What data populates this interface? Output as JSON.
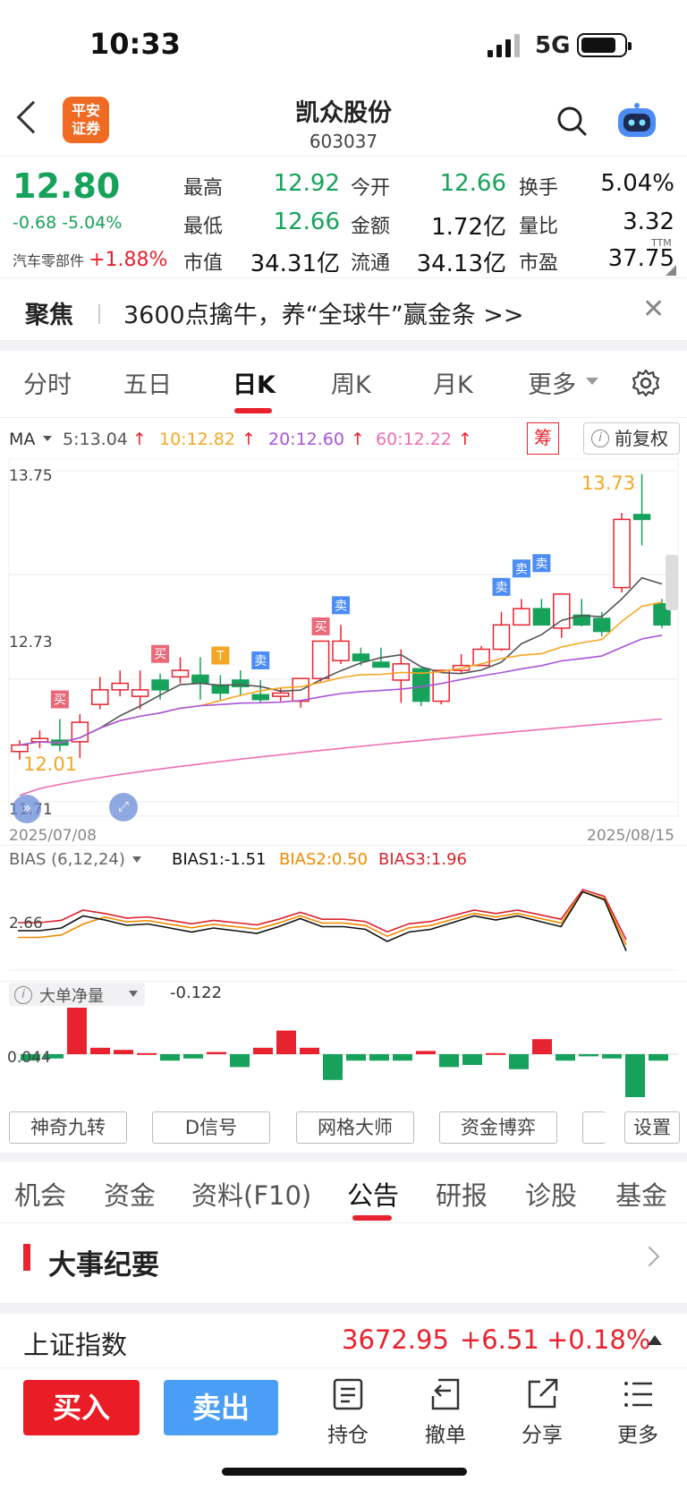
{
  "status_bar": {
    "time": "10:33",
    "network": "5G"
  },
  "header": {
    "broker_logo": "平安证券",
    "stock_name": "凯众股份",
    "stock_code": "603037"
  },
  "quote": {
    "price": "12.80",
    "change": "-0.68 -5.04%",
    "sector_name": "汽车零部件",
    "sector_change": "+1.88%",
    "fields": [
      {
        "label": "最高",
        "value": "12.92",
        "color": "#17a25b"
      },
      {
        "label": "今开",
        "value": "12.66",
        "color": "#17a25b"
      },
      {
        "label": "换手",
        "value": "5.04%",
        "color": "#111"
      },
      {
        "label": "最低",
        "value": "12.66",
        "color": "#17a25b"
      },
      {
        "label": "金额",
        "value": "1.72亿",
        "color": "#111"
      },
      {
        "label": "量比",
        "value": "3.32",
        "color": "#111"
      },
      {
        "label": "市值",
        "value": "34.31亿",
        "color": "#111"
      },
      {
        "label": "流通",
        "value": "34.13亿",
        "color": "#111"
      },
      {
        "label": "市盈",
        "value": "37.75",
        "color": "#111"
      }
    ],
    "pe_sup": "TTM"
  },
  "focus": {
    "label": "聚焦",
    "text": "3600点擒牛，养“全球牛”赢金条 >>",
    "close": "✕"
  },
  "chart_tabs": [
    "分时",
    "五日",
    "日K",
    "周K",
    "月K",
    "更多"
  ],
  "active_chart_tab": "日K",
  "ma_line": {
    "label": "MA",
    "items": [
      {
        "text": "5:13.04",
        "color": "#555"
      },
      {
        "text": "10:12.82",
        "color": "#f5a623"
      },
      {
        "text": "20:12.60",
        "color": "#a855d8"
      },
      {
        "text": "60:12.22",
        "color": "#ec6fb4"
      }
    ],
    "arrow": "↑",
    "chou": "筹",
    "restore": "前复权"
  },
  "kline": {
    "y_high": "13.75",
    "y_mid": "12.73",
    "y_low": "11.71",
    "date_start": "2025/07/08",
    "date_end": "2025/08/15",
    "max_label": "13.73",
    "min_label": "12.01",
    "signals": [
      "买",
      "买",
      "T",
      "卖",
      "卖",
      "买",
      "卖",
      "卖",
      "卖"
    ]
  },
  "bias": {
    "label": "BIAS (6,12,24)",
    "b1": "BIAS1:-1.51",
    "b2": "BIAS2:0.50",
    "b3": "BIAS3:1.96",
    "y_label": "2.66"
  },
  "big_order": {
    "label": "大单净量",
    "value": "-0.122",
    "y_label": "0.044"
  },
  "tool_buttons": [
    "神奇九转",
    "D信号",
    "网格大师",
    "资金博弈",
    "设置"
  ],
  "content_tabs": [
    "机会",
    "资金",
    "资料(F10)",
    "公告",
    "研报",
    "诊股",
    "基金"
  ],
  "active_content_tab": "公告",
  "event_section": {
    "title": "大事纪要"
  },
  "index": {
    "name": "上证指数",
    "value": "3672.95",
    "change": "+6.51",
    "pct": "+0.18%"
  },
  "bottom_bar": {
    "buy": "买入",
    "sell": "卖出",
    "items": [
      "持仓",
      "撤单",
      "分享",
      "更多"
    ]
  },
  "chart_data": {
    "type": "candlestick",
    "title": "",
    "categories_range": [
      "2025/07/08",
      "2025/08/15"
    ],
    "ylim": [
      11.71,
      13.75
    ],
    "ohlc": [
      [
        12.02,
        12.09,
        11.97,
        12.06
      ],
      [
        12.08,
        12.15,
        12.04,
        12.1
      ],
      [
        12.09,
        12.22,
        12.02,
        12.06
      ],
      [
        12.08,
        12.25,
        11.98,
        12.2
      ],
      [
        12.31,
        12.48,
        12.28,
        12.4
      ],
      [
        12.4,
        12.52,
        12.36,
        12.44
      ],
      [
        12.36,
        12.52,
        12.28,
        12.4
      ],
      [
        12.46,
        12.5,
        12.34,
        12.4
      ],
      [
        12.48,
        12.6,
        12.44,
        12.52
      ],
      [
        12.49,
        12.6,
        12.34,
        12.44
      ],
      [
        12.43,
        12.49,
        12.33,
        12.38
      ],
      [
        12.46,
        12.52,
        12.36,
        12.42
      ],
      [
        12.37,
        12.46,
        12.32,
        12.34
      ],
      [
        12.36,
        12.41,
        12.33,
        12.38
      ],
      [
        12.33,
        12.46,
        12.29,
        12.47
      ],
      [
        12.47,
        12.67,
        12.45,
        12.7
      ],
      [
        12.58,
        12.8,
        12.56,
        12.7
      ],
      [
        12.62,
        12.66,
        12.55,
        12.58
      ],
      [
        12.57,
        12.66,
        12.54,
        12.54
      ],
      [
        12.46,
        12.65,
        12.32,
        12.56
      ],
      [
        12.53,
        12.53,
        12.3,
        12.33
      ],
      [
        12.33,
        12.52,
        12.31,
        12.52
      ],
      [
        12.52,
        12.62,
        12.5,
        12.55
      ],
      [
        12.55,
        12.67,
        12.55,
        12.65
      ],
      [
        12.65,
        12.88,
        12.64,
        12.8
      ],
      [
        12.8,
        12.96,
        12.8,
        12.9
      ],
      [
        12.9,
        12.96,
        12.83,
        12.8
      ],
      [
        12.78,
        12.99,
        12.72,
        12.99
      ],
      [
        12.86,
        12.96,
        12.79,
        12.8
      ],
      [
        12.84,
        12.88,
        12.73,
        12.76
      ],
      [
        13.03,
        13.49,
        13.0,
        13.45
      ],
      [
        13.48,
        13.73,
        13.29,
        13.45
      ],
      [
        12.93,
        12.96,
        12.78,
        12.8
      ]
    ]
  }
}
